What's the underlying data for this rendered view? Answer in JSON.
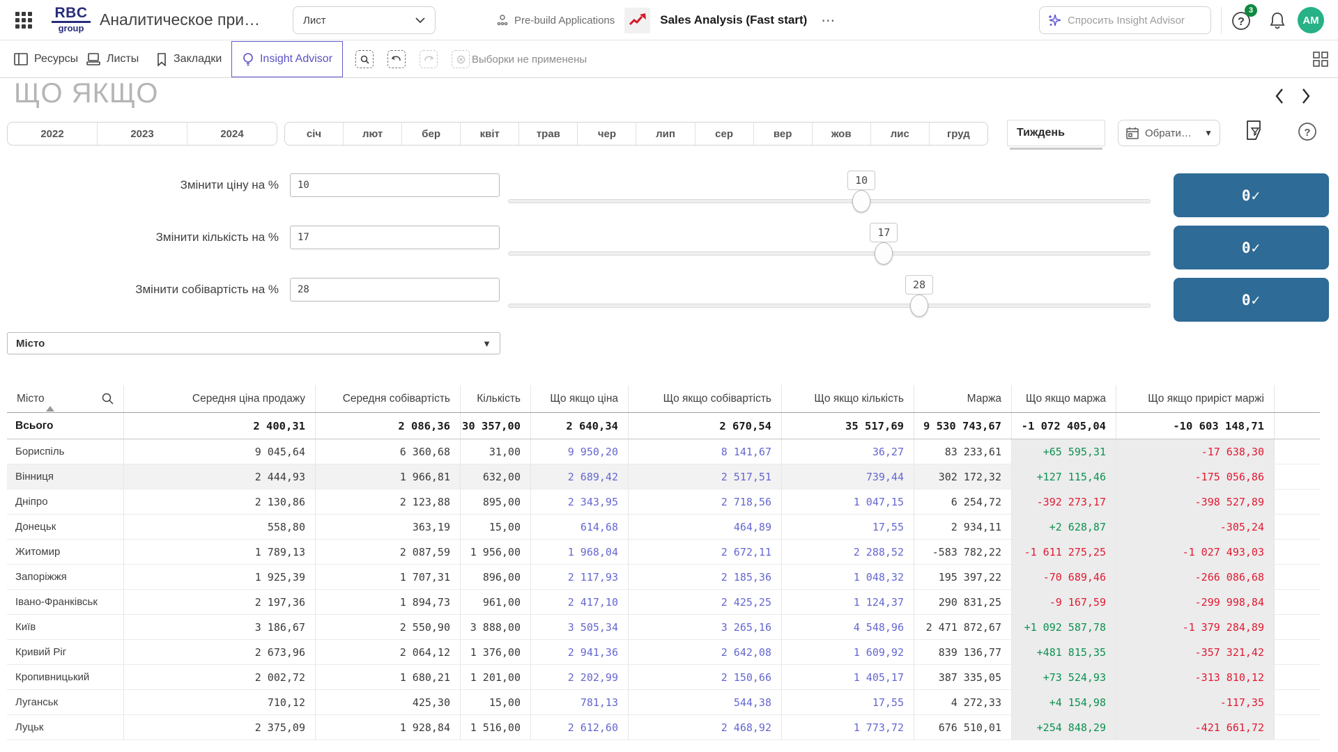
{
  "navbar": {
    "logo_top": "RBC",
    "logo_bottom": "group",
    "app_title": "Аналитическое при…",
    "sheet_selector": "Лист",
    "prebuilt_label": "Pre-build Applications",
    "app_name": "Sales Analysis (Fast start)",
    "more_label": "⋯",
    "search_placeholder": "Спросить Insight Advisor",
    "help_badge": "3",
    "avatar_initials": "AM"
  },
  "toolbar": {
    "resources": "Ресурсы",
    "sheets": "Листы",
    "bookmarks": "Закладки",
    "insight_advisor": "Insight Advisor",
    "selections_status": "Выборки не применены"
  },
  "sheet": {
    "title": "ЩО ЯКЩО"
  },
  "filters": {
    "years": [
      "2022",
      "2023",
      "2024"
    ],
    "months": [
      "січ",
      "лют",
      "бер",
      "квіт",
      "трав",
      "чер",
      "лип",
      "сер",
      "вер",
      "жов",
      "лис",
      "груд"
    ],
    "week_label": "Тиждень",
    "date_picker_label": "Обрати…"
  },
  "whatif": {
    "range_min": -100,
    "range_max": 100,
    "apply_label": "0✓",
    "rows": [
      {
        "label": "Змінити ціну на %",
        "value": "10",
        "slider_value": 10
      },
      {
        "label": "Змінити кількість на %",
        "value": "17",
        "slider_value": 17
      },
      {
        "label": "Змінити собівартість на %",
        "value": "28",
        "slider_value": 28
      }
    ]
  },
  "city_filter": {
    "label": "Місто"
  },
  "table": {
    "columns": [
      "Місто",
      "Середня ціна продажу",
      "Середня собівартість",
      "Кількість",
      "Що якщо ціна",
      "Що якщо собівартість",
      "Що якщо кількість",
      "Маржа",
      "Що якщо маржа",
      "Що якщо приріст маржі"
    ],
    "total": [
      "Всього",
      "2 400,31",
      "2 086,36",
      "30 357,00",
      "2 640,34",
      "2 670,54",
      "35 517,69",
      "9 530 743,67",
      "-1 072 405,04",
      "-10 603 148,71"
    ],
    "rows": [
      {
        "cells": [
          "Бориспіль",
          "9 045,64",
          "6 360,68",
          "31,00",
          "9 950,20",
          "8 141,67",
          "36,27",
          "83 233,61",
          "+65 595,31",
          "-17 638,30"
        ],
        "hover": false
      },
      {
        "cells": [
          "Вінниця",
          "2 444,93",
          "1 966,81",
          "632,00",
          "2 689,42",
          "2 517,51",
          "739,44",
          "302 172,32",
          "+127 115,46",
          "-175 056,86"
        ],
        "hover": true
      },
      {
        "cells": [
          "Дніпро",
          "2 130,86",
          "2 123,88",
          "895,00",
          "2 343,95",
          "2 718,56",
          "1 047,15",
          "6 254,72",
          "-392 273,17",
          "-398 527,89"
        ],
        "hover": false
      },
      {
        "cells": [
          "Донецьк",
          "558,80",
          "363,19",
          "15,00",
          "614,68",
          "464,89",
          "17,55",
          "2 934,11",
          "+2 628,87",
          "-305,24"
        ],
        "hover": false
      },
      {
        "cells": [
          "Житомир",
          "1 789,13",
          "2 087,59",
          "1 956,00",
          "1 968,04",
          "2 672,11",
          "2 288,52",
          "-583 782,22",
          "-1 611 275,25",
          "-1 027 493,03"
        ],
        "hover": false
      },
      {
        "cells": [
          "Запоріжжя",
          "1 925,39",
          "1 707,31",
          "896,00",
          "2 117,93",
          "2 185,36",
          "1 048,32",
          "195 397,22",
          "-70 689,46",
          "-266 086,68"
        ],
        "hover": false
      },
      {
        "cells": [
          "Івано-Франківськ",
          "2 197,36",
          "1 894,73",
          "961,00",
          "2 417,10",
          "2 425,25",
          "1 124,37",
          "290 831,25",
          "-9 167,59",
          "-299 998,84"
        ],
        "hover": false
      },
      {
        "cells": [
          "Київ",
          "3 186,67",
          "2 550,90",
          "3 888,00",
          "3 505,34",
          "3 265,16",
          "4 548,96",
          "2 471 872,67",
          "+1 092 587,78",
          "-1 379 284,89"
        ],
        "hover": false
      },
      {
        "cells": [
          "Кривий Ріг",
          "2 673,96",
          "2 064,12",
          "1 376,00",
          "2 941,36",
          "2 642,08",
          "1 609,92",
          "839 136,77",
          "+481 815,35",
          "-357 321,42"
        ],
        "hover": false
      },
      {
        "cells": [
          "Кропивницький",
          "2 002,72",
          "1 680,21",
          "1 201,00",
          "2 202,99",
          "2 150,66",
          "1 405,17",
          "387 335,05",
          "+73 524,93",
          "-313 810,12"
        ],
        "hover": false
      },
      {
        "cells": [
          "Луганськ",
          "710,12",
          "425,30",
          "15,00",
          "781,13",
          "544,38",
          "17,55",
          "4 272,33",
          "+4 154,98",
          "-117,35"
        ],
        "hover": false
      },
      {
        "cells": [
          "Луцьк",
          "2 375,09",
          "1 928,84",
          "1 516,00",
          "2 612,60",
          "2 468,92",
          "1 773,72",
          "676 510,01",
          "+254 848,29",
          "-421 661,72"
        ],
        "hover": false
      }
    ]
  },
  "colors": {
    "accent_button": "#2e6b96",
    "whatif_value": "#6467d0",
    "positive": "#0c9150",
    "negative": "#e11931",
    "insight_purple": "#5a52c4",
    "avatar_green": "#27b187",
    "badge_green": "#0e8a41"
  }
}
